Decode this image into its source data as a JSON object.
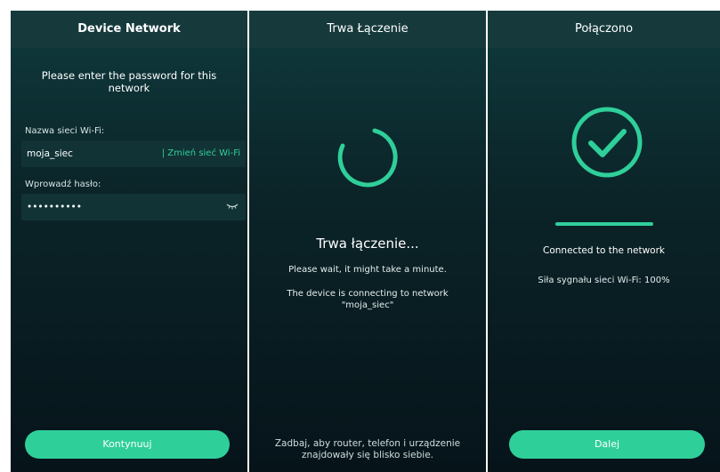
{
  "colors": {
    "accent": "#2fcf9a",
    "background": "#0b2428",
    "header": "#163a3c"
  },
  "screen1": {
    "header_title": "Device Network",
    "prompt": "Please enter the password for this network",
    "ssid_label": "Nazwa sieci Wi-Fi:",
    "ssid_value": "moja_siec",
    "change_network": "| Zmień sieć Wi-Fi",
    "password_label": "Wprowadź hasło:",
    "password_value": "••••••••••",
    "password_visibility_icon": "eye-closed-icon",
    "continue_button": "Kontynuuj"
  },
  "screen2": {
    "header_title": "Trwa Łączenie",
    "spinner_icon": "loading-spinner-icon",
    "title": "Trwa łączenie...",
    "wait_text": "Please wait, it might take a minute.",
    "connecting_text": "The device is connecting to network",
    "network_name": "\"moja_siec\"",
    "tip": "Zadbaj, aby router, telefon i urządzenie znajdowały się blisko siebie."
  },
  "screen3": {
    "header_title": "Połączono",
    "check_icon": "check-circle-icon",
    "progress": 1.0,
    "connected_text": "Connected to the network",
    "signal_text": "Siła sygnału sieci Wi-Fi: 100%",
    "next_button": "Dalej"
  }
}
